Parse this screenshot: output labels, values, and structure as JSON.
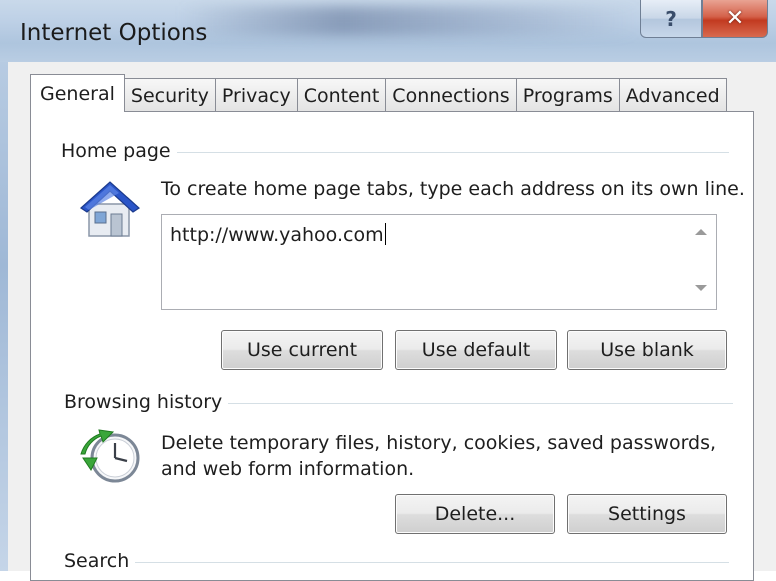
{
  "window": {
    "title": "Internet Options",
    "help_glyph": "?",
    "close_glyph": "✕"
  },
  "tabs": [
    {
      "label": "General",
      "active": true
    },
    {
      "label": "Security"
    },
    {
      "label": "Privacy"
    },
    {
      "label": "Content"
    },
    {
      "label": "Connections"
    },
    {
      "label": "Programs"
    },
    {
      "label": "Advanced"
    }
  ],
  "home_page": {
    "group_label": "Home page",
    "description": "To create home page tabs, type each address on its own line.",
    "value": "http://www.yahoo.com",
    "icon": "home-icon",
    "buttons": {
      "use_current": "Use current",
      "use_default": "Use default",
      "use_blank": "Use blank"
    }
  },
  "browsing_history": {
    "group_label": "Browsing history",
    "description_line1": "Delete temporary files, history, cookies, saved passwords,",
    "description_line2": "and web form information.",
    "icon": "history-clock-icon",
    "buttons": {
      "delete": "Delete...",
      "settings": "Settings"
    }
  },
  "search": {
    "group_label": "Search"
  },
  "colors": {
    "tab_border": "#898c95",
    "close_red": "#c23a20",
    "home_roof_blue": "#2a55c8",
    "history_green": "#3aa63a"
  }
}
